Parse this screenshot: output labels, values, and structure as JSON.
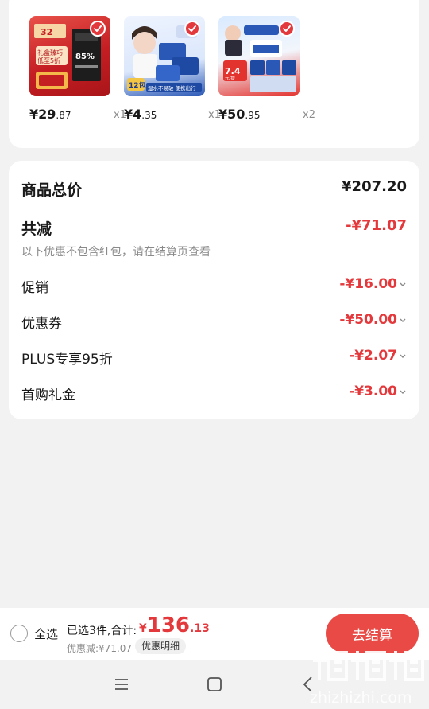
{
  "products": [
    {
      "name": "lindt-chocolate",
      "price_int": "¥29",
      "price_dec": ".87",
      "qty": "x1"
    },
    {
      "name": "vinda-tissue-pack",
      "price_int": "¥4",
      "price_dec": ".35",
      "qty": "x1"
    },
    {
      "name": "tempo-tissue-box",
      "price_int": "¥50",
      "price_dec": ".95",
      "qty": "x2"
    }
  ],
  "product_thumb_text": {
    "p1_badge": "32",
    "p1_line1": "礼盒臻巧",
    "p1_line2": "低至5折",
    "p1_pct": "85%",
    "p2_badge": "12包",
    "p2_caption": "湿水不易破 便携出行",
    "p3_price": "7.4",
    "p3_unit": "元/提"
  },
  "summary": {
    "total_label": "商品总价",
    "total_value": "¥207.20",
    "reduce_label": "共减",
    "reduce_value": "-¥71.07",
    "note": "以下优惠不包含红包，请在结算页查看",
    "rows": [
      {
        "label": "促销",
        "value": "-¥16.00"
      },
      {
        "label": "优惠券",
        "value": "-¥50.00"
      },
      {
        "label": "PLUS专享95折",
        "value": "-¥2.07"
      },
      {
        "label": "首购礼金",
        "value": "-¥3.00"
      }
    ]
  },
  "bottom_bar": {
    "select_all": "全选",
    "selected_text": "已选3件,合计:",
    "amount_currency": "¥",
    "amount_int": "136",
    "amount_dec": ".13",
    "discount_text": "优惠减:¥71.07",
    "detail_button": "优惠明细",
    "checkout_button": "去结算"
  },
  "watermark": "zhizhizhi.com",
  "colors": {
    "accent": "#e4393c",
    "checkout": "#e94a45",
    "background": "#f2f2f2"
  },
  "icons": [
    "check-icon",
    "chevron-down-icon",
    "menu-icon",
    "home-icon",
    "back-icon",
    "radio-circle-icon"
  ]
}
